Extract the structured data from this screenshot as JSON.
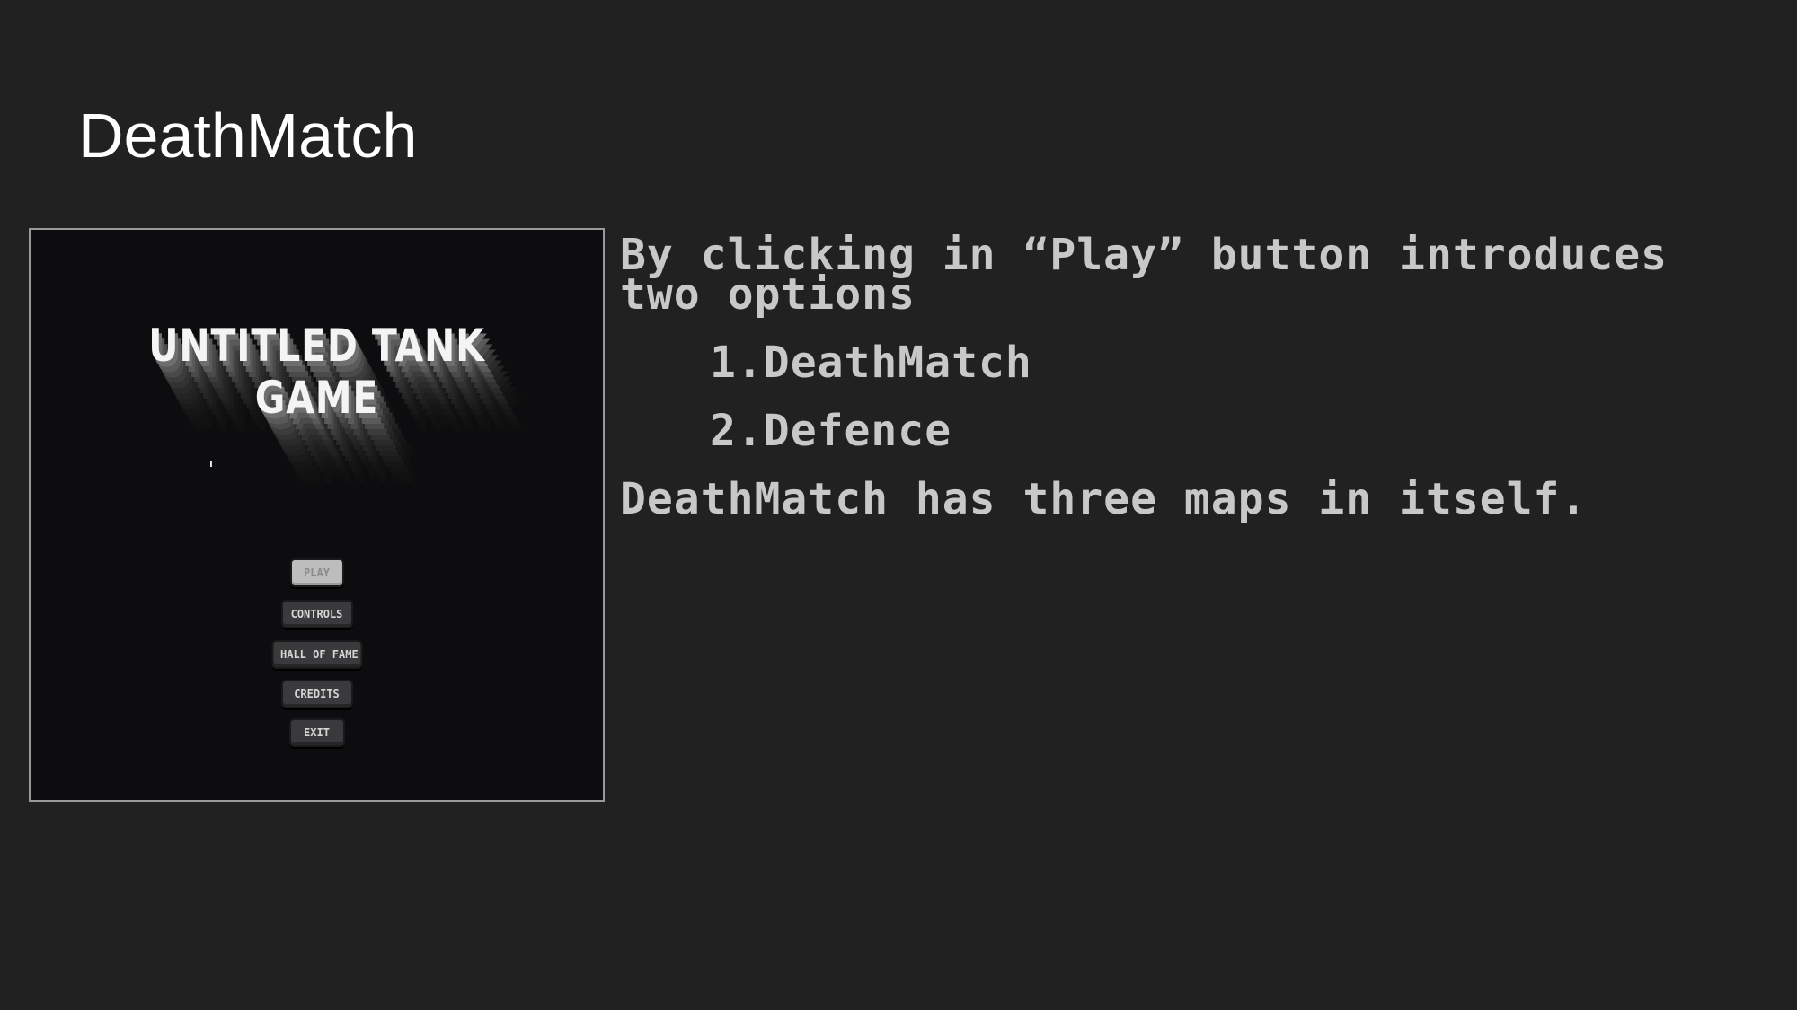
{
  "slide": {
    "title": "DeathMatch"
  },
  "game_screen": {
    "game_title": "UNTITLED TANK GAME",
    "menu": [
      {
        "label": "PLAY",
        "active": true
      },
      {
        "label": "CONTROLS",
        "active": false
      },
      {
        "label": "HALL OF FAME",
        "active": false
      },
      {
        "label": "CREDITS",
        "active": false
      },
      {
        "label": "EXIT",
        "active": false
      }
    ]
  },
  "description": {
    "intro": "By clicking in “Play” button introduces two options",
    "options": [
      "1.DeathMatch",
      "2.Defence"
    ],
    "outro": "DeathMatch has three maps in itself."
  },
  "colors": {
    "background": "#212121",
    "title_text": "#ffffff",
    "body_text": "#c8c8c8",
    "game_background": "#0d0d0f"
  }
}
